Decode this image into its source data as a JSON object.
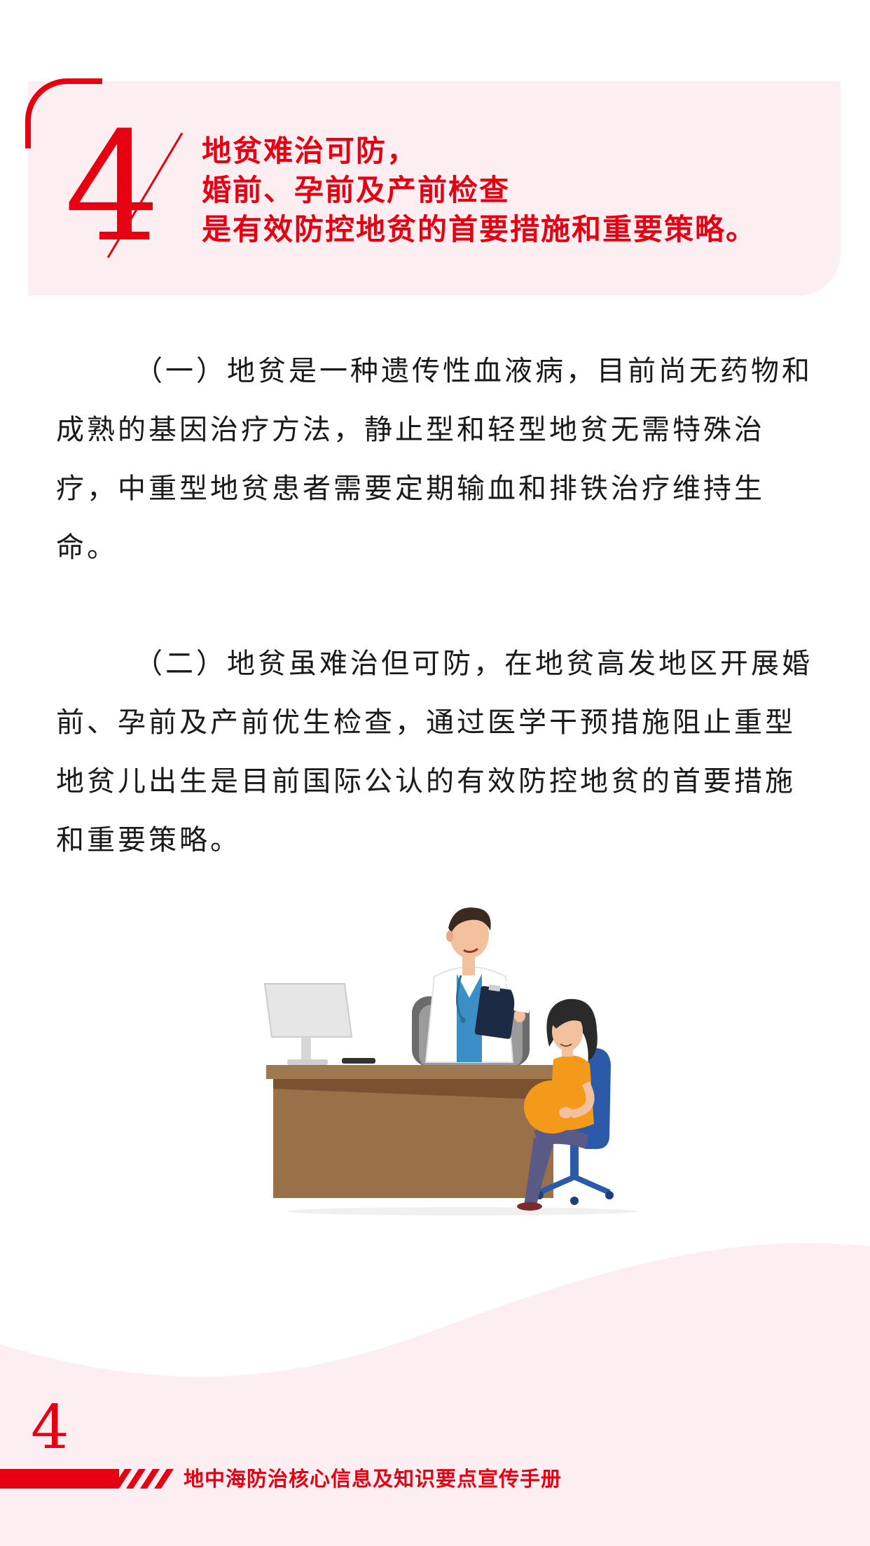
{
  "section": {
    "number": "4",
    "heading_lines": [
      "地贫难治可防，",
      "婚前、孕前及产前检查",
      "是有效防控地贫的首要措施和重要策略。"
    ]
  },
  "paragraphs": [
    "（一）地贫是一种遗传性血液病，目前尚无药物和成熟的基因治疗方法，静止型和轻型地贫无需特殊治疗，中重型地贫患者需要定期输血和排铁治疗维持生命。",
    "（二）地贫虽难治但可防，在地贫高发地区开展婚前、孕前及产前优生检查，通过医学干预措施阻止重型地贫儿出生是目前国际公认的有效防控地贫的首要措施和重要策略。"
  ],
  "footer": {
    "page_number": "4",
    "handbook_title": "地中海防治核心信息及知识要点宣传手册"
  },
  "colors": {
    "accent_red": "#e60012",
    "panel_pink": "#fdeef1"
  }
}
